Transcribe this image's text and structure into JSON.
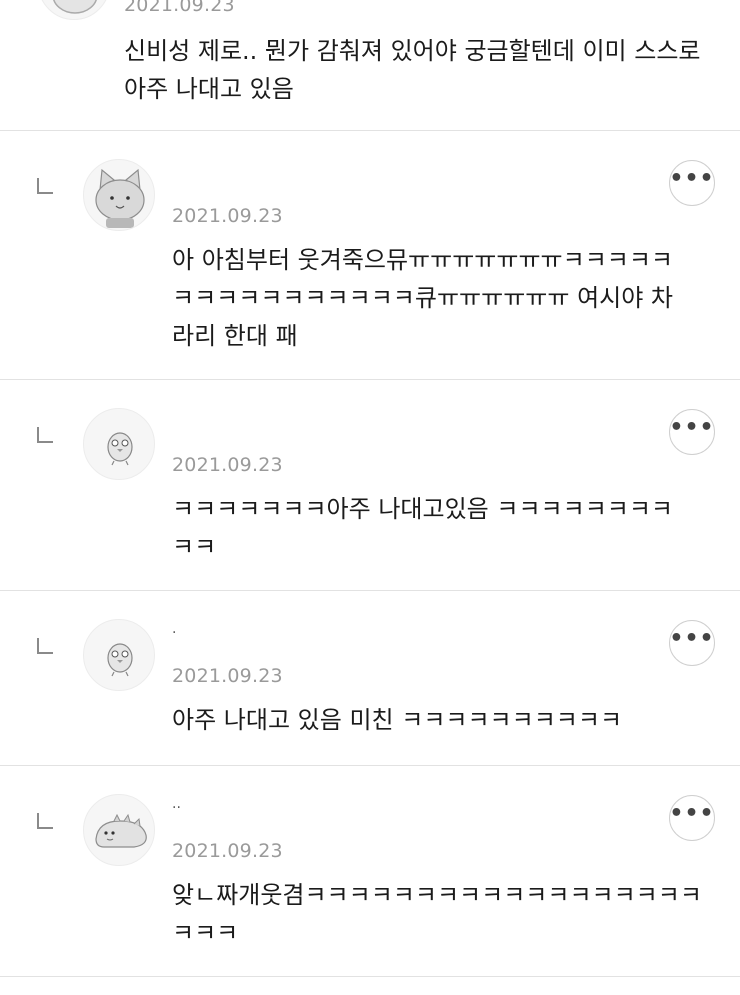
{
  "comments": [
    {
      "date": "2021.09.23",
      "text": "신비성 제로.. 뭔가 감춰져 있어야 궁금할텐데 이미 스스로 아주 나대고 있음",
      "avatar": "cat-avatar"
    },
    {
      "date": "2021.09.23",
      "text": "아 아침부터 웃겨죽으뮤ㅠㅠㅠㅠㅠㅠㅠㅋㅋㅋㅋㅋㅋㅋㅋㅋㅋㅋㅋㅋㅋㅋㅋ큐ㅠㅠㅠㅠㅠㅠ 여시야 차라리 한대 패",
      "avatar": "cat-avatar",
      "more_label": "•••"
    },
    {
      "date": "2021.09.23",
      "text": "ㅋㅋㅋㅋㅋㅋㅋ아주 나대고있음 ㅋㅋㅋㅋㅋㅋㅋㅋㅋㅋ",
      "avatar": "penguin-avatar",
      "more_label": "•••"
    },
    {
      "nickname": "·",
      "date": "2021.09.23",
      "text": "아주 나대고 있음 미친 ㅋㅋㅋㅋㅋㅋㅋㅋㅋㅋ",
      "avatar": "penguin-avatar",
      "more_label": "•••"
    },
    {
      "nickname": "··",
      "date": "2021.09.23",
      "text": "앚ㄴ짜개웃겸ㅋㅋㅋㅋㅋㅋㅋㅋㅋㅋㅋㅋㅋㅋㅋㅋㅋㅋㅋㅋㅋ",
      "avatar": "dino-avatar",
      "more_label": "•••"
    }
  ]
}
